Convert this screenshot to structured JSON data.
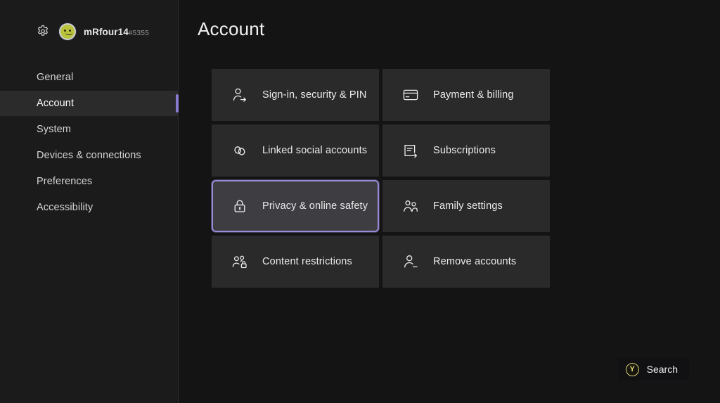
{
  "sidebar": {
    "gear_icon": "gear-icon",
    "avatar_icon": "avatar",
    "gamertag": "mRfour14",
    "gamertag_suffix": "#5355",
    "items": [
      {
        "label": "General",
        "selected": false
      },
      {
        "label": "Account",
        "selected": true
      },
      {
        "label": "System",
        "selected": false
      },
      {
        "label": "Devices & connections",
        "selected": false
      },
      {
        "label": "Preferences",
        "selected": false
      },
      {
        "label": "Accessibility",
        "selected": false
      }
    ]
  },
  "main": {
    "title": "Account",
    "tiles": [
      {
        "label": "Sign-in, security & PIN",
        "icon": "person-arrow-icon",
        "focused": false
      },
      {
        "label": "Payment & billing",
        "icon": "credit-card-icon",
        "focused": false
      },
      {
        "label": "Linked social accounts",
        "icon": "link-icon",
        "focused": false
      },
      {
        "label": "Subscriptions",
        "icon": "document-renew-icon",
        "focused": false
      },
      {
        "label": "Privacy & online safety",
        "icon": "lock-icon",
        "focused": true
      },
      {
        "label": "Family settings",
        "icon": "people-icon",
        "focused": false
      },
      {
        "label": "Content restrictions",
        "icon": "people-lock-icon",
        "focused": false
      },
      {
        "label": "Remove accounts",
        "icon": "person-minus-icon",
        "focused": false
      }
    ]
  },
  "footer": {
    "search_label": "Search",
    "search_button_glyph": "Y",
    "search_button_icon": "y-button-icon"
  },
  "colors": {
    "accent_purple": "#8a7bd0",
    "focus_border": "#9b8ad8",
    "tile_bg": "#2a2a2a",
    "tile_focus_bg": "#3d3d42",
    "sidebar_bg": "#1b1b1b",
    "main_bg": "#141414",
    "y_button": "#d9cf73"
  }
}
